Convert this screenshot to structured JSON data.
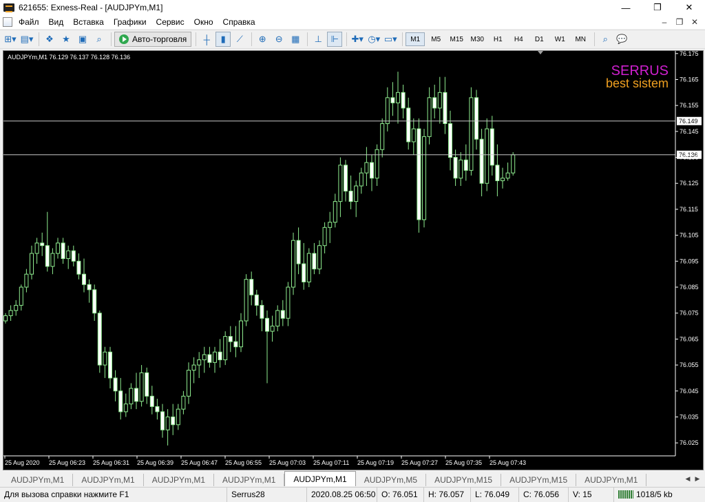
{
  "window": {
    "title": "621655: Exness-Real - [AUDJPYm,M1]"
  },
  "menu": {
    "items": [
      "Файл",
      "Вид",
      "Вставка",
      "Графики",
      "Сервис",
      "Окно",
      "Справка"
    ]
  },
  "toolbar": {
    "autotrading_label": "Авто-торговля",
    "timeframes": [
      "M1",
      "M5",
      "M15",
      "M30",
      "H1",
      "H4",
      "D1",
      "W1",
      "MN"
    ],
    "active_timeframe": "M1"
  },
  "chart": {
    "header": "AUDJPYm,M1  76.129 76.137 76.128 76.136",
    "overlay_line1": "SERRUS",
    "overlay_line2": "best sistem",
    "overlay_color1": "#d020d0",
    "overlay_color2": "#f0a020",
    "hline_labels": [
      "76.149",
      "76.136"
    ]
  },
  "chart_data": {
    "type": "candlestick",
    "symbol": "AUDJPYm",
    "timeframe": "M1",
    "ylim": [
      76.02,
      76.176
    ],
    "y_ticks": [
      "76.175",
      "76.165",
      "76.155",
      "76.145",
      "76.135",
      "76.125",
      "76.115",
      "76.105",
      "76.095",
      "76.085",
      "76.075",
      "76.065",
      "76.055",
      "76.045",
      "76.035",
      "76.025"
    ],
    "x_ticks": [
      "25 Aug 2020",
      "25 Aug 06:23",
      "25 Aug 06:31",
      "25 Aug 06:39",
      "25 Aug 06:47",
      "25 Aug 06:55",
      "25 Aug 07:03",
      "25 Aug 07:11",
      "25 Aug 07:19",
      "25 Aug 07:27",
      "25 Aug 07:35",
      "25 Aug 07:43"
    ],
    "horizontal_lines": [
      76.149,
      76.136
    ],
    "candle_color": "#90ee90",
    "ohlc": [
      [
        76.072,
        76.075,
        76.071,
        76.074
      ],
      [
        76.074,
        76.078,
        76.072,
        76.076
      ],
      [
        76.076,
        76.08,
        76.074,
        76.078
      ],
      [
        76.078,
        76.086,
        76.076,
        76.085
      ],
      [
        76.085,
        76.092,
        76.083,
        76.09
      ],
      [
        76.09,
        76.101,
        76.088,
        76.098
      ],
      [
        76.098,
        76.104,
        76.094,
        76.102
      ],
      [
        76.102,
        76.106,
        76.097,
        76.101
      ],
      [
        76.101,
        76.114,
        76.091,
        76.093
      ],
      [
        76.093,
        76.1,
        76.09,
        76.098
      ],
      [
        76.098,
        76.104,
        76.096,
        76.102
      ],
      [
        76.102,
        76.104,
        76.094,
        76.096
      ],
      [
        76.096,
        76.101,
        76.092,
        76.099
      ],
      [
        76.099,
        76.101,
        76.093,
        76.095
      ],
      [
        76.095,
        76.098,
        76.088,
        76.09
      ],
      [
        76.09,
        76.096,
        76.083,
        76.086
      ],
      [
        76.086,
        76.088,
        76.079,
        76.084
      ],
      [
        76.084,
        76.086,
        76.072,
        76.075
      ],
      [
        76.075,
        76.076,
        76.052,
        76.055
      ],
      [
        76.055,
        76.062,
        76.05,
        76.06
      ],
      [
        76.06,
        76.062,
        76.046,
        76.05
      ],
      [
        76.05,
        76.053,
        76.041,
        76.045
      ],
      [
        76.045,
        76.05,
        76.034,
        76.037
      ],
      [
        76.037,
        76.044,
        76.035,
        76.04
      ],
      [
        76.04,
        76.048,
        76.038,
        76.046
      ],
      [
        76.046,
        76.052,
        76.038,
        76.041
      ],
      [
        76.041,
        76.055,
        76.039,
        76.052
      ],
      [
        76.052,
        76.054,
        76.04,
        76.043
      ],
      [
        76.043,
        76.047,
        76.036,
        76.039
      ],
      [
        76.039,
        76.042,
        76.034,
        76.037
      ],
      [
        76.037,
        76.04,
        76.027,
        76.03
      ],
      [
        76.03,
        76.038,
        76.024,
        76.035
      ],
      [
        76.035,
        76.04,
        76.028,
        76.032
      ],
      [
        76.032,
        76.04,
        76.03,
        76.038
      ],
      [
        76.038,
        76.045,
        76.036,
        76.043
      ],
      [
        76.043,
        76.056,
        76.04,
        76.053
      ],
      [
        76.053,
        76.058,
        76.048,
        76.055
      ],
      [
        76.055,
        76.06,
        76.05,
        76.057
      ],
      [
        76.057,
        76.062,
        76.052,
        76.059
      ],
      [
        76.059,
        76.062,
        76.054,
        76.056
      ],
      [
        76.056,
        76.062,
        76.052,
        76.06
      ],
      [
        76.06,
        76.065,
        76.054,
        76.057
      ],
      [
        76.057,
        76.068,
        76.055,
        76.066
      ],
      [
        76.066,
        76.07,
        76.06,
        76.064
      ],
      [
        76.064,
        76.07,
        76.058,
        76.062
      ],
      [
        76.062,
        76.075,
        76.06,
        76.072
      ],
      [
        76.072,
        76.09,
        76.07,
        76.088
      ],
      [
        76.088,
        76.091,
        76.078,
        76.082
      ],
      [
        76.082,
        76.084,
        76.074,
        76.078
      ],
      [
        76.078,
        76.08,
        76.068,
        76.073
      ],
      [
        76.073,
        76.076,
        76.048,
        76.068
      ],
      [
        76.068,
        76.074,
        76.064,
        76.07
      ],
      [
        76.07,
        76.078,
        76.068,
        76.076
      ],
      [
        76.076,
        76.08,
        76.07,
        76.073
      ],
      [
        76.073,
        76.087,
        76.07,
        76.085
      ],
      [
        76.085,
        76.106,
        76.082,
        76.103
      ],
      [
        76.103,
        76.108,
        76.09,
        76.094
      ],
      [
        76.094,
        76.102,
        76.084,
        76.087
      ],
      [
        76.087,
        76.1,
        76.085,
        76.098
      ],
      [
        76.098,
        76.102,
        76.09,
        76.092
      ],
      [
        76.092,
        76.103,
        76.09,
        76.101
      ],
      [
        76.101,
        76.11,
        76.098,
        76.108
      ],
      [
        76.108,
        76.114,
        76.102,
        76.11
      ],
      [
        76.11,
        76.121,
        76.108,
        76.118
      ],
      [
        76.118,
        76.135,
        76.112,
        76.132
      ],
      [
        76.132,
        76.134,
        76.118,
        76.122
      ],
      [
        76.122,
        76.128,
        76.115,
        76.118
      ],
      [
        76.118,
        76.126,
        76.112,
        76.124
      ],
      [
        76.124,
        76.131,
        76.121,
        76.129
      ],
      [
        76.129,
        76.139,
        76.124,
        76.133
      ],
      [
        76.133,
        76.136,
        76.122,
        76.127
      ],
      [
        76.127,
        76.14,
        76.124,
        76.138
      ],
      [
        76.138,
        76.15,
        76.135,
        76.148
      ],
      [
        76.148,
        76.162,
        76.145,
        76.158
      ],
      [
        76.158,
        76.164,
        76.151,
        76.156
      ],
      [
        76.156,
        76.168,
        76.148,
        76.16
      ],
      [
        76.16,
        76.163,
        76.15,
        76.154
      ],
      [
        76.154,
        76.158,
        76.138,
        76.141
      ],
      [
        76.141,
        76.15,
        76.136,
        76.146
      ],
      [
        76.146,
        76.15,
        76.106,
        76.111
      ],
      [
        76.111,
        76.146,
        76.108,
        76.143
      ],
      [
        76.143,
        76.162,
        76.14,
        76.158
      ],
      [
        76.158,
        76.163,
        76.15,
        76.154
      ],
      [
        76.154,
        76.166,
        76.148,
        76.16
      ],
      [
        76.16,
        76.166,
        76.144,
        76.148
      ],
      [
        76.148,
        76.153,
        76.13,
        76.135
      ],
      [
        76.135,
        76.138,
        76.124,
        76.127
      ],
      [
        76.127,
        76.137,
        76.124,
        76.134
      ],
      [
        76.134,
        76.14,
        76.126,
        76.13
      ],
      [
        76.13,
        76.162,
        76.128,
        76.158
      ],
      [
        76.158,
        76.161,
        76.138,
        76.142
      ],
      [
        76.142,
        76.146,
        76.12,
        76.125
      ],
      [
        76.125,
        76.15,
        76.122,
        76.146
      ],
      [
        76.146,
        76.151,
        76.128,
        76.132
      ],
      [
        76.132,
        76.14,
        76.12,
        76.126
      ],
      [
        76.126,
        76.131,
        76.123,
        76.127
      ],
      [
        76.127,
        76.133,
        76.126,
        76.129
      ],
      [
        76.129,
        76.137,
        76.128,
        76.136
      ]
    ]
  },
  "tabs": {
    "items": [
      "AUDJPYm,M1",
      "AUDJPYm,M1",
      "AUDJPYm,M1",
      "AUDJPYm,M1",
      "AUDJPYm,M1",
      "AUDJPYm,M5",
      "AUDJPYm,M15",
      "AUDJPYm,M15",
      "AUDJPYm,M1"
    ],
    "active_index": 4
  },
  "status": {
    "help": "Для вызова справки нажмите F1",
    "profile": "Serrus28",
    "datetime": "2020.08.25 06:50",
    "open": "O: 76.051",
    "high": "H: 76.057",
    "low": "L: 76.049",
    "close": "C: 76.056",
    "volume": "V: 15",
    "traffic": "1018/5 kb"
  }
}
